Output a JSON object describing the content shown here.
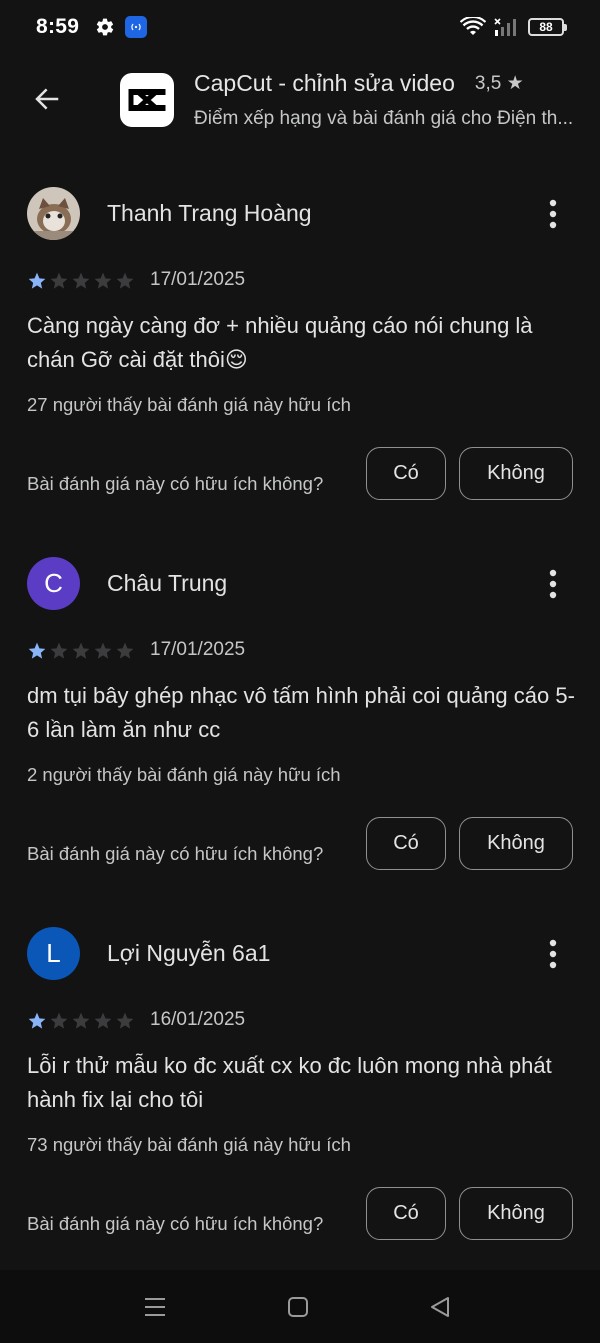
{
  "status_bar": {
    "time": "8:59",
    "battery": "88"
  },
  "header": {
    "back_icon": "arrow-left-icon",
    "app_name": "CapCut - chỉnh sửa video",
    "rating": "3,5",
    "rating_star": "★",
    "subtitle": "Điểm xếp hạng và bài đánh giá cho Điện th..."
  },
  "colors": {
    "star_filled": "#8ab4f8",
    "star_empty": "#3c3c3e",
    "avatar_purple": "#5b3cc4",
    "avatar_blue": "#0b57b7"
  },
  "reviews": [
    {
      "name": "Thanh Trang Hoàng",
      "avatar_type": "photo",
      "avatar_letter": "",
      "stars": 1,
      "max_stars": 5,
      "date": "17/01/2025",
      "text": "Càng ngày càng đơ + nhiều quảng cáo nói chung là chán Gỡ cài đặt thôi😌",
      "helpful_count": "27 người thấy bài đánh giá này hữu ích",
      "helpful_question": "Bài đánh giá này có hữu ích không?",
      "yes_label": "Có",
      "no_label": "Không"
    },
    {
      "name": "Châu Trung",
      "avatar_type": "letter",
      "avatar_letter": "C",
      "stars": 1,
      "max_stars": 5,
      "date": "17/01/2025",
      "text": "dm tụi bây ghép nhạc vô tấm hình phải coi quảng cáo 5-6 lần làm ăn như cc",
      "helpful_count": "2 người thấy bài đánh giá này hữu ích",
      "helpful_question": "Bài đánh giá này có hữu ích không?",
      "yes_label": "Có",
      "no_label": "Không"
    },
    {
      "name": "Lợi Nguyễn 6a1",
      "avatar_type": "letter",
      "avatar_letter": "L",
      "stars": 1,
      "max_stars": 5,
      "date": "16/01/2025",
      "text": "Lỗi r thử mẫu ko đc xuất cx ko đc luôn mong nhà phát hành fix lại cho tôi",
      "helpful_count": "73 người thấy bài đánh giá này hữu ích",
      "helpful_question": "Bài đánh giá này có hữu ích không?",
      "yes_label": "Có",
      "no_label": "Không"
    }
  ],
  "nav_bar": {
    "items": [
      "menu-icon",
      "home-icon",
      "back-triangle-icon"
    ]
  }
}
